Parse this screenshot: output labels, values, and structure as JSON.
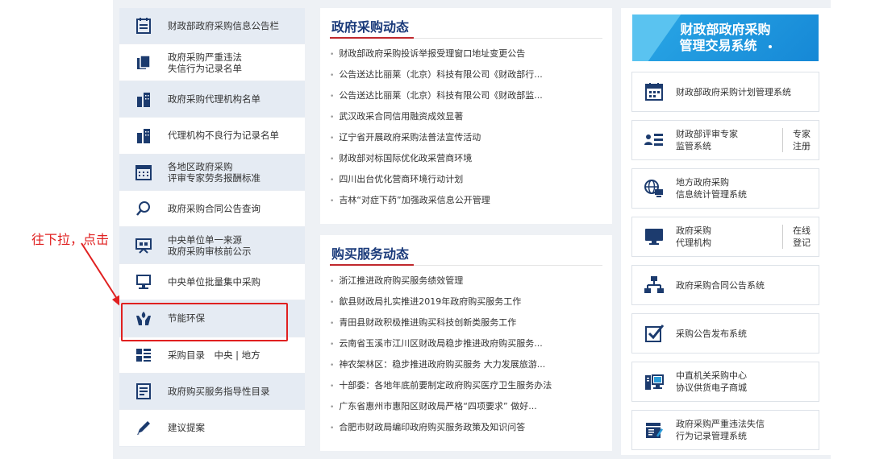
{
  "left_menu": [
    {
      "line1": "财政部政府采购信息公告栏",
      "line2": "",
      "icon": "notice-icon"
    },
    {
      "line1": "政府采购严重违法",
      "line2": "失信行为记录名单",
      "icon": "document-stack-icon"
    },
    {
      "line1": "政府采购代理机构名单",
      "line2": "",
      "icon": "building-icon"
    },
    {
      "line1": "代理机构不良行为记录名单",
      "line2": "",
      "icon": "building-icon"
    },
    {
      "line1": "各地区政府采购",
      "line2": "评审专家劳务报酬标准",
      "icon": "calendar-grid-icon"
    },
    {
      "line1": "政府采购合同公告查询",
      "line2": "",
      "icon": "search-icon"
    },
    {
      "line1": "中央单位单一来源",
      "line2": "政府采购审核前公示",
      "icon": "presentation-icon"
    },
    {
      "line1": "中央单位批量集中采购",
      "line2": "",
      "icon": "monitor-icon"
    },
    {
      "line1": "节能环保",
      "line2": "",
      "icon": "eco-hands-icon"
    },
    {
      "line1": "采购目录　中央 | 地方",
      "line2": "",
      "icon": "grid-list-icon"
    },
    {
      "line1": "政府购买服务指导性目录",
      "line2": "",
      "icon": "list-document-icon"
    },
    {
      "line1": "建议提案",
      "line2": "",
      "icon": "pen-icon"
    }
  ],
  "annotation": {
    "text": "往下拉，点击",
    "color": "#e02020"
  },
  "gov_news": {
    "title": "政府采购动态",
    "items": [
      "财政部政府采购投诉举报受理窗口地址变更公告",
      "公告送达比丽莱（北京）科技有限公司《财政部行...",
      "公告送达比丽莱（北京）科技有限公司《财政部监...",
      "武汉政采合同信用融资成效显著",
      "辽宁省开展政府采购法普法宣传活动",
      "财政部对标国际优化政采营商环境",
      "四川出台优化营商环境行动计划",
      "吉林“对症下药”加强政采信息公开管理"
    ]
  },
  "service_news": {
    "title": "购买服务动态",
    "items": [
      "浙江推进政府购买服务绩效管理",
      "歙县财政局扎实推进2019年政府购买服务工作",
      "青田县财政积极推进购买科技创新类服务工作",
      "云南省玉溪市江川区财政局稳步推进政府购买服务...",
      "神农架林区：稳步推进政府购买服务 大力发展旅游...",
      "十部委：各地年底前要制定政府购买医疗卫生服务办法",
      "广东省惠州市惠阳区财政局严格“四项要求” 做好...",
      "合肥市财政局编印政府购买服务政策及知识问答"
    ]
  },
  "banner": {
    "line1": "财政部政府采购",
    "line2": "管理交易系统"
  },
  "systems": [
    {
      "line1": "财政部政府采购计划管理系统",
      "line2": "",
      "side1": "",
      "side2": "",
      "icon": "calendar-icon"
    },
    {
      "line1": "财政部评审专家",
      "line2": "监管系统",
      "side1": "专家",
      "side2": "注册",
      "icon": "expert-list-icon"
    },
    {
      "line1": "地方政府采购",
      "line2": "信息统计管理系统",
      "side1": "",
      "side2": "",
      "icon": "globe-computer-icon"
    },
    {
      "line1": "政府采购",
      "line2": "代理机构",
      "side1": "在线",
      "side2": "登记",
      "icon": "monitor-icon"
    },
    {
      "line1": "政府采购合同公告系统",
      "line2": "",
      "side1": "",
      "side2": "",
      "icon": "network-icon"
    },
    {
      "line1": "采购公告发布系统",
      "line2": "",
      "side1": "",
      "side2": "",
      "icon": "checkbox-icon"
    },
    {
      "line1": "中直机关采购中心",
      "line2": "协议供货电子商城",
      "side1": "",
      "side2": "",
      "icon": "desktop-computer-icon"
    },
    {
      "line1": "政府采购严重违法失信",
      "line2": "行为记录管理系统",
      "side1": "",
      "side2": "",
      "icon": "record-icon"
    }
  ]
}
